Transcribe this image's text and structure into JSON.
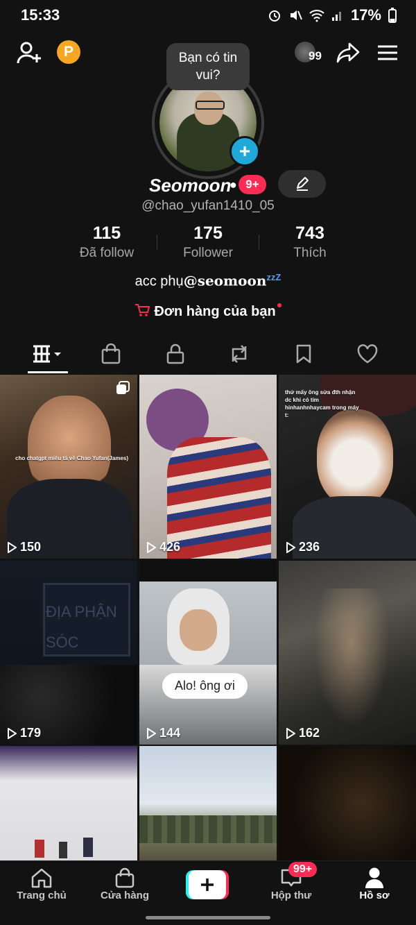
{
  "status_bar": {
    "time": "15:33",
    "battery": "17%"
  },
  "header": {
    "tooltip": "Bạn có tin vui?",
    "inbox_badge": "99"
  },
  "profile": {
    "display_name": "Seomoon",
    "name_badge": "9+",
    "username": "@chao_yufan1410_05",
    "stats": [
      {
        "value": "115",
        "label": "Đã follow"
      },
      {
        "value": "175",
        "label": "Follower"
      },
      {
        "value": "743",
        "label": "Thích"
      }
    ],
    "bio_prefix": "acc phụ",
    "bio_handle": "@seomoon",
    "orders_label": "Đơn hàng của bạn"
  },
  "videos": [
    {
      "views": "150",
      "caption": "cho chatgpt miêu tả về Chao Yufan(James)"
    },
    {
      "views": "426",
      "caption": ""
    },
    {
      "views": "236",
      "caption": "thứ mấy ông sửa đth nhận dc khi có tim hinhanhnhaycam trong máy t:"
    },
    {
      "views": "179",
      "caption": "ĐỊA PHẬN SÓC TRĂNG"
    },
    {
      "views": "144",
      "caption": "Alo! ông ơi"
    },
    {
      "views": "162",
      "caption": ""
    },
    {
      "views": "",
      "caption": ""
    },
    {
      "views": "",
      "caption": ""
    },
    {
      "views": "",
      "caption": ""
    }
  ],
  "bottom_nav": [
    {
      "label": "Trang chủ",
      "icon": "home-icon"
    },
    {
      "label": "Cửa hàng",
      "icon": "shop-icon"
    },
    {
      "label": "",
      "icon": "create-icon"
    },
    {
      "label": "Hộp thư",
      "icon": "inbox-icon",
      "badge": "99+"
    },
    {
      "label": "Hồ sơ",
      "icon": "profile-icon"
    }
  ],
  "colors": {
    "accent": "#fe2c55",
    "background": "#121212",
    "plus_blue": "#20a8d8"
  }
}
